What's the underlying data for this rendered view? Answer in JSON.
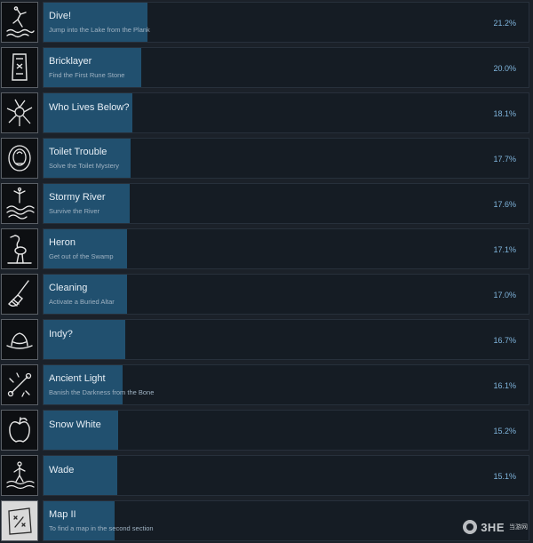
{
  "achievements": [
    {
      "title": "Dive!",
      "desc": "Jump into the Lake from the Plank",
      "pct": "21.2%",
      "progress": 0.212,
      "icon": "diver-icon"
    },
    {
      "title": "Bricklayer",
      "desc": "Find the First Rune Stone",
      "pct": "20.0%",
      "progress": 0.2,
      "icon": "rune-stone-icon"
    },
    {
      "title": "Who Lives Below?",
      "desc": "",
      "pct": "18.1%",
      "progress": 0.181,
      "icon": "creature-icon"
    },
    {
      "title": "Toilet Trouble",
      "desc": "Solve the Toilet Mystery",
      "pct": "17.7%",
      "progress": 0.177,
      "icon": "toilet-mystery-icon"
    },
    {
      "title": "Stormy River",
      "desc": "Survive the River",
      "pct": "17.6%",
      "progress": 0.176,
      "icon": "river-icon"
    },
    {
      "title": "Heron",
      "desc": "Get out of the Swamp",
      "pct": "17.1%",
      "progress": 0.171,
      "icon": "heron-icon"
    },
    {
      "title": "Cleaning",
      "desc": "Activate a Buried Altar",
      "pct": "17.0%",
      "progress": 0.17,
      "icon": "broom-icon"
    },
    {
      "title": "Indy?",
      "desc": "",
      "pct": "16.7%",
      "progress": 0.167,
      "icon": "hat-icon"
    },
    {
      "title": "Ancient Light",
      "desc": "Banish the Darkness from the Bone",
      "pct": "16.1%",
      "progress": 0.161,
      "icon": "bone-light-icon"
    },
    {
      "title": "Snow White",
      "desc": "",
      "pct": "15.2%",
      "progress": 0.152,
      "icon": "apple-icon"
    },
    {
      "title": "Wade",
      "desc": "",
      "pct": "15.1%",
      "progress": 0.151,
      "icon": "wading-figure-icon"
    },
    {
      "title": "Map II",
      "desc": "To find a map in the second section",
      "pct": "",
      "progress": 0.145,
      "icon": "map-icon"
    }
  ],
  "watermark": {
    "text": "3HE",
    "chinese": "当游网"
  }
}
